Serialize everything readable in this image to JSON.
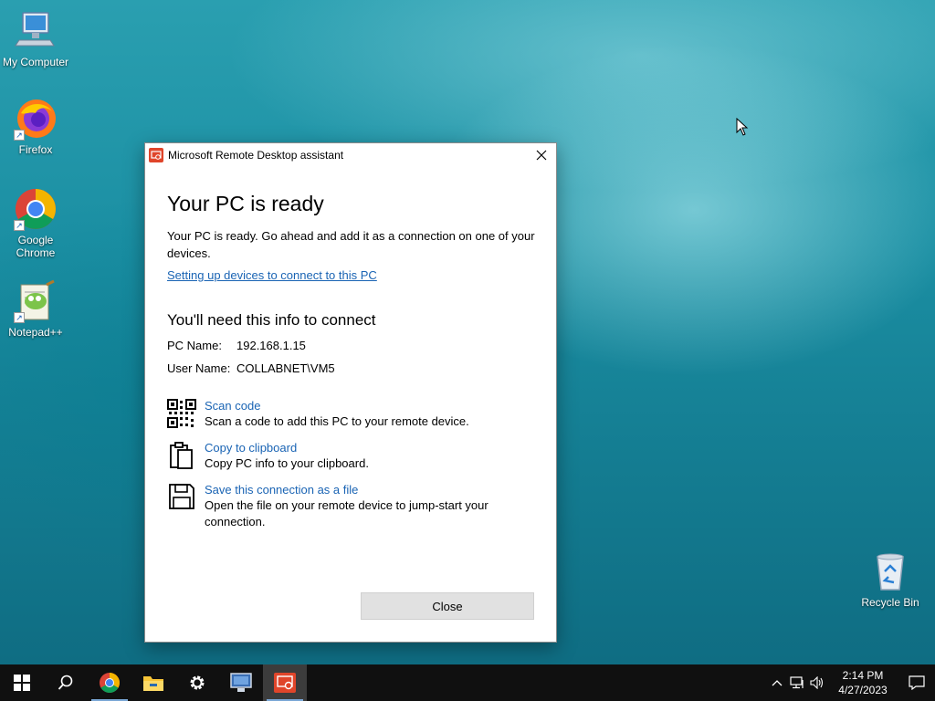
{
  "desktop": {
    "icons": [
      {
        "label": "My Computer"
      },
      {
        "label": "Firefox"
      },
      {
        "label": "Google Chrome"
      },
      {
        "label": "Notepad++"
      },
      {
        "label": "Recycle Bin"
      }
    ]
  },
  "dialog": {
    "title": "Microsoft Remote Desktop assistant",
    "heading": "Your PC is ready",
    "description": "Your PC is ready. Go ahead and add it as a connection on one of your devices.",
    "setup_link": "Setting up devices to connect to this PC",
    "info_heading": "You'll need this info to connect",
    "pc_name_label": "PC Name:",
    "pc_name_value": "192.168.1.15",
    "user_name_label": "User Name:",
    "user_name_value": "COLLABNET\\VM5",
    "actions": [
      {
        "title": "Scan code",
        "desc": "Scan a code to add this PC to your remote device.",
        "icon": "qr-code-icon"
      },
      {
        "title": "Copy to clipboard",
        "desc": "Copy PC info to your clipboard.",
        "icon": "clipboard-icon"
      },
      {
        "title": "Save this connection as a file",
        "desc": "Open the file on your remote device to jump-start your connection.",
        "icon": "floppy-disk-icon"
      }
    ],
    "close_label": "Close"
  },
  "taskbar": {
    "time": "2:14 PM",
    "date": "4/27/2023"
  },
  "colors": {
    "link": "#1a64b4",
    "accent": "#e0452a"
  }
}
